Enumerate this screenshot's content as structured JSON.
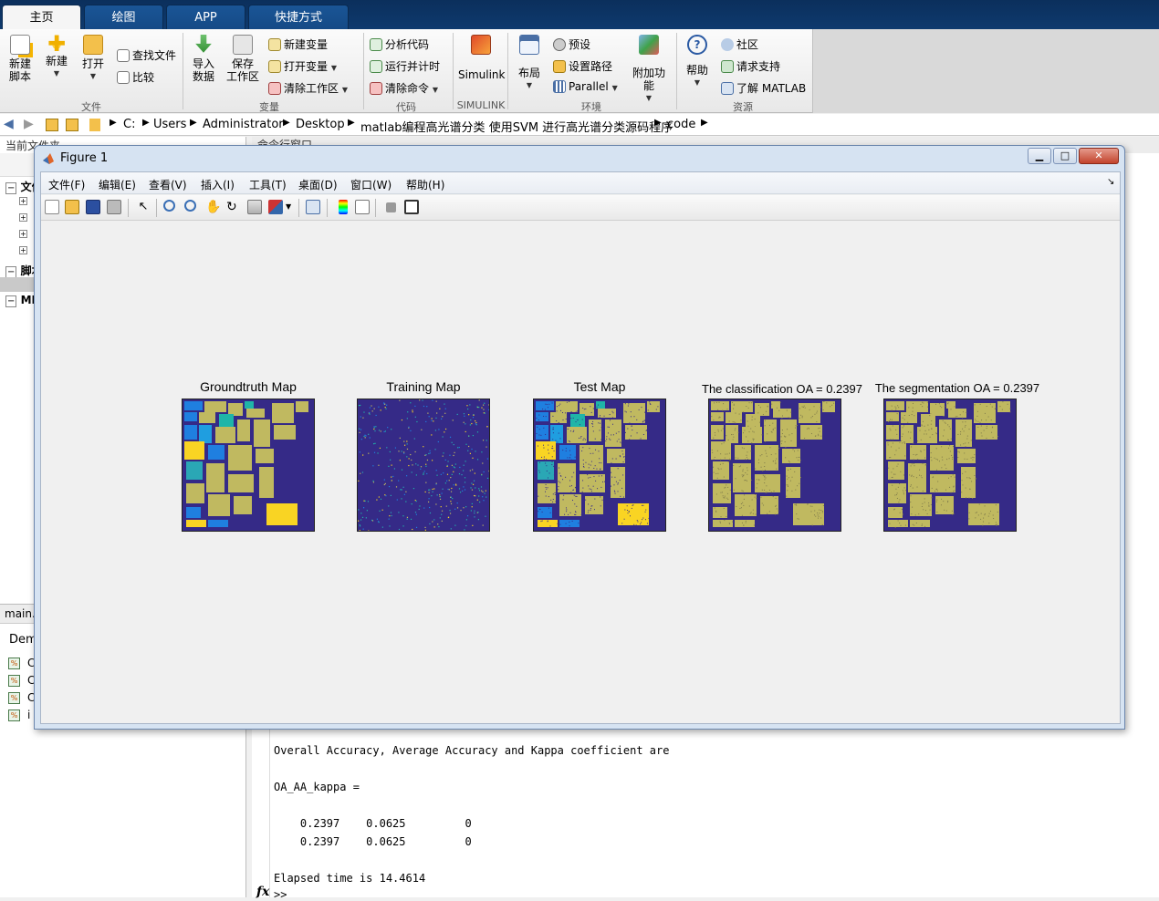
{
  "tabs": [
    {
      "label": "主页",
      "active": true
    },
    {
      "label": "绘图",
      "active": false
    },
    {
      "label": "APP",
      "active": false
    },
    {
      "label": "快捷方式",
      "active": false
    }
  ],
  "ribbon": {
    "file": {
      "new_script": "新建\n脚本",
      "new": "新建",
      "open": "打开",
      "find_files": "查找文件",
      "compare": "比较",
      "group": "文件"
    },
    "variable": {
      "import": "导入\n数据",
      "save_ws": "保存\n工作区",
      "new_var": "新建变量",
      "open_var": "打开变量",
      "clear_ws": "清除工作区",
      "group": "变量"
    },
    "code": {
      "analyze": "分析代码",
      "run_time": "运行并计时",
      "clear_cmd": "清除命令",
      "group": "代码"
    },
    "simulink": {
      "label": "Simulink",
      "group": "SIMULINK"
    },
    "env": {
      "layout": "布局",
      "prefs": "预设",
      "set_path": "设置路径",
      "parallel": "Parallel",
      "addons": "附加功能",
      "group": "环境"
    },
    "resources": {
      "help": "帮助",
      "community": "社区",
      "support": "请求支持",
      "learn": "了解 MATLAB",
      "group": "资源"
    }
  },
  "address": {
    "crumbs": [
      "C:",
      "Users",
      "Administrator",
      "Desktop",
      "matlab编程高光谱分类 使用SVM 进行高光谱分类源码程序",
      "code"
    ]
  },
  "left_panel": {
    "title": "当前文件夹",
    "tree": [
      "文件",
      "脚本",
      "MD"
    ],
    "detail_tab": "main.",
    "detail_label": "Dem",
    "files": [
      "C",
      "C",
      "C",
      "i"
    ]
  },
  "command": {
    "title": "命令行窗口",
    "lines": [
      "Overall Accuracy, Average Accuracy and Kappa coefficient are",
      "OA_AA_kappa =",
      "    0.2397    0.0625         0",
      "    0.2397    0.0625         0",
      "Elapsed time is 14.4614",
      ">>"
    ],
    "fx": "fx"
  },
  "figure": {
    "title": "Figure 1",
    "menus": [
      "文件(F)",
      "编辑(E)",
      "查看(V)",
      "插入(I)",
      "工具(T)",
      "桌面(D)",
      "窗口(W)",
      "帮助(H)"
    ],
    "plots": [
      {
        "title": "Groundtruth Map"
      },
      {
        "title": "Training Map"
      },
      {
        "title": "Test Map"
      },
      {
        "title": "The classification OA = 0.2397"
      },
      {
        "title": "The segmentation OA = 0.2397"
      }
    ]
  },
  "colors": {
    "background_class": "#352a87",
    "majority_class": "#c0b960",
    "accent_yellow": "#f9d423",
    "accent_blue": "#1f7fe0",
    "accent_teal": "#1fb5a8"
  }
}
